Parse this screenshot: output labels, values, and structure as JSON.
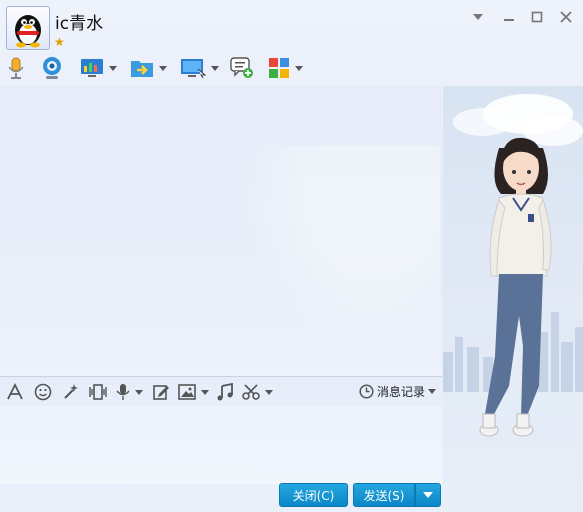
{
  "window": {
    "contact_name": "ic青水",
    "status_icon": "star-icon",
    "controls": [
      "dropdown-icon",
      "minimize-icon",
      "maximize-icon",
      "close-icon"
    ]
  },
  "toolbar": {
    "items": [
      "microphone-icon",
      "video-camera-icon",
      "remote-assist-icon",
      "send-file-icon",
      "screen-share-icon",
      "create-discussion-icon",
      "apps-icon"
    ]
  },
  "input_toolbar": {
    "items": [
      "font-icon",
      "emoji-icon",
      "magic-wand-icon",
      "window-shake-icon",
      "voice-message-icon",
      "edit-note-icon",
      "image-icon",
      "music-icon",
      "screenshot-scissors-icon"
    ],
    "history_label": "消息记录"
  },
  "buttons": {
    "close_label": "关闭(C)",
    "send_label": "发送(S)"
  },
  "colors": {
    "button": "#0f8fd0",
    "background": "#e6edf9",
    "side_panel": "#dde6f3"
  }
}
